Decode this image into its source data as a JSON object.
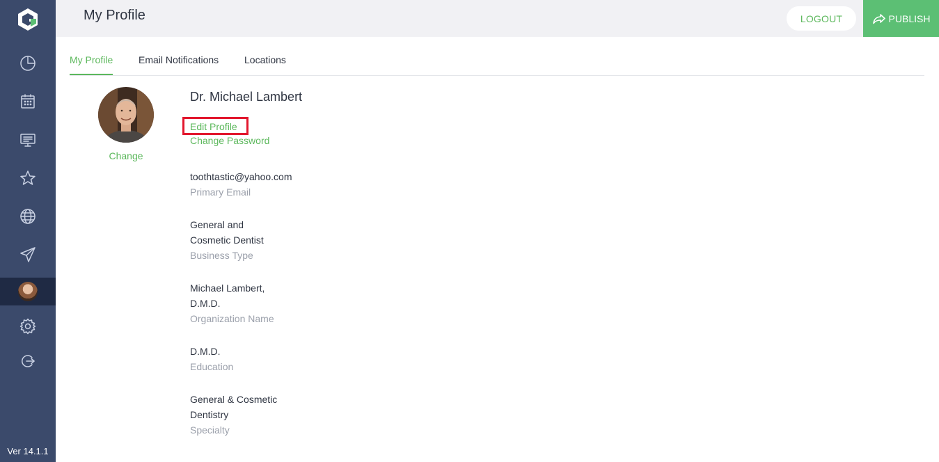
{
  "app": {
    "version": "Ver 14.1.1",
    "sidebar": {
      "items": [
        {
          "icon": "dashboard-icon"
        },
        {
          "icon": "calendar-icon"
        },
        {
          "icon": "monitor-icon"
        },
        {
          "icon": "star-icon"
        },
        {
          "icon": "globe-icon"
        },
        {
          "icon": "send-icon"
        },
        {
          "icon": "user-avatar-icon",
          "active": true
        },
        {
          "icon": "gear-icon"
        },
        {
          "icon": "logout-icon"
        }
      ]
    }
  },
  "header": {
    "title": "My Profile",
    "logout_label": "LOGOUT",
    "publish_label": "PUBLISH"
  },
  "tabs": [
    {
      "label": "My Profile",
      "active": true
    },
    {
      "label": "Email Notifications",
      "active": false
    },
    {
      "label": "Locations",
      "active": false
    }
  ],
  "profile": {
    "change_photo_label": "Change",
    "name": "Dr. Michael Lambert",
    "edit_profile_label": "Edit Profile",
    "change_password_label": "Change Password",
    "fields": [
      {
        "value_lines": [
          "toothtastic@yahoo.com"
        ],
        "label": "Primary Email"
      },
      {
        "value_lines": [
          "General and",
          "Cosmetic Dentist"
        ],
        "label": "Business Type"
      },
      {
        "value_lines": [
          "Michael Lambert,",
          "D.M.D."
        ],
        "label": "Organization Name"
      },
      {
        "value_lines": [
          "D.M.D."
        ],
        "label": "Education"
      },
      {
        "value_lines": [
          "General & Cosmetic",
          "Dentistry"
        ],
        "label": "Specialty"
      }
    ]
  },
  "colors": {
    "sidebar": "#3b4a6b",
    "accent_green": "#5cb85c",
    "publish_green": "#5cbf74",
    "highlight_red": "#e2172d"
  }
}
